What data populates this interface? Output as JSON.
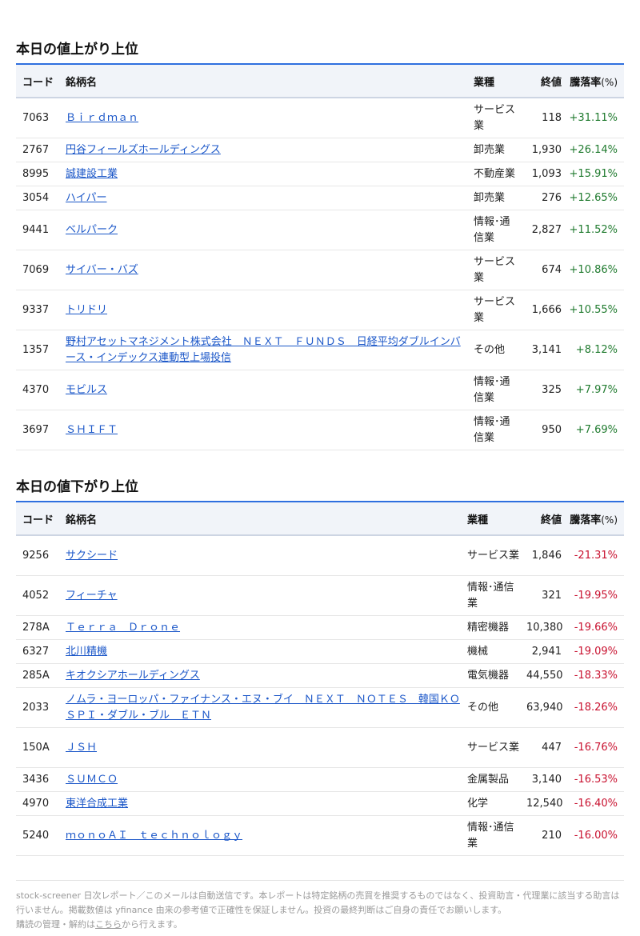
{
  "gainers": {
    "title": "本日の値上がり上位",
    "headers": {
      "code": "コード",
      "name": "銘柄名",
      "sector": "業種",
      "close": "終値",
      "change": "騰落率",
      "unit": "(%)"
    },
    "rows": [
      {
        "code": "7063",
        "name": "Ｂｉｒｄｍａｎ",
        "sector": "サービス業",
        "close": "118",
        "change": "+31.11%"
      },
      {
        "code": "2767",
        "name": "円谷フィールズホールディングス",
        "sector": "卸売業",
        "close": "1,930",
        "change": "+26.14%"
      },
      {
        "code": "8995",
        "name": "誠建設工業",
        "sector": "不動産業",
        "close": "1,093",
        "change": "+15.91%"
      },
      {
        "code": "3054",
        "name": "ハイパー",
        "sector": "卸売業",
        "close": "276",
        "change": "+12.65%"
      },
      {
        "code": "9441",
        "name": "ベルパーク",
        "sector": "情報･通信業",
        "close": "2,827",
        "change": "+11.52%"
      },
      {
        "code": "7069",
        "name": "サイバー・バズ",
        "sector": "サービス業",
        "close": "674",
        "change": "+10.86%"
      },
      {
        "code": "9337",
        "name": "トリドリ",
        "sector": "サービス業",
        "close": "1,666",
        "change": "+10.55%"
      },
      {
        "code": "1357",
        "name": "野村アセットマネジメント株式会社　ＮＥＸＴ　ＦＵＮＤＳ　日経平均ダブルインバース・インデックス連動型上場投信",
        "sector": "その他",
        "close": "3,141",
        "change": "+8.12%"
      },
      {
        "code": "4370",
        "name": "モビルス",
        "sector": "情報･通信業",
        "close": "325",
        "change": "+7.97%"
      },
      {
        "code": "3697",
        "name": "ＳＨＩＦＴ",
        "sector": "情報･通信業",
        "close": "950",
        "change": "+7.69%"
      }
    ]
  },
  "losers": {
    "title": "本日の値下がり上位",
    "headers": {
      "code": "コード",
      "name": "銘柄名",
      "sector": "業種",
      "close": "終値",
      "change": "騰落率",
      "unit": "(%)"
    },
    "rows": [
      {
        "code": "9256",
        "name": "サクシード",
        "sector": "サービス業",
        "close": "1,846",
        "change": "-21.31%"
      },
      {
        "code": "4052",
        "name": "フィーチャ",
        "sector": "情報･通信業",
        "close": "321",
        "change": "-19.95%"
      },
      {
        "code": "278A",
        "name": "Ｔｅｒｒａ　Ｄｒｏｎｅ",
        "sector": "精密機器",
        "close": "10,380",
        "change": "-19.66%"
      },
      {
        "code": "6327",
        "name": "北川精機",
        "sector": "機械",
        "close": "2,941",
        "change": "-19.09%"
      },
      {
        "code": "285A",
        "name": "キオクシアホールディングス",
        "sector": "電気機器",
        "close": "44,550",
        "change": "-18.33%"
      },
      {
        "code": "2033",
        "name": "ノムラ・ヨーロッパ・ファイナンス・エヌ・ブイ　ＮＥＸＴ　ＮＯＴＥＳ　韓国ＫＯＳＰＩ・ダブル・ブル　ＥＴＮ",
        "sector": "その他",
        "close": "63,940",
        "change": "-18.26%"
      },
      {
        "code": "150A",
        "name": "ＪＳＨ",
        "sector": "サービス業",
        "close": "447",
        "change": "-16.76%"
      },
      {
        "code": "3436",
        "name": "ＳＵＭＣＯ",
        "sector": "金属製品",
        "close": "3,140",
        "change": "-16.53%"
      },
      {
        "code": "4970",
        "name": "東洋合成工業",
        "sector": "化学",
        "close": "12,540",
        "change": "-16.40%"
      },
      {
        "code": "5240",
        "name": "ｍｏｎｏＡＩ　ｔｅｃｈｎｏｌｏｇｙ",
        "sector": "情報･通信業",
        "close": "210",
        "change": "-16.00%"
      }
    ]
  },
  "footer": {
    "line1": "stock-screener 日次レポート／このメールは自動送信です。本レポートは特定銘柄の売買を推奨するものではなく、投資助言・代理業に該当する助言は行いません。掲載数値は yfinance 由来の参考値で正確性を保証しません。投資の最終判断はご自身の責任でお願いします。",
    "unsubscribe_prefix": "購読の管理・解約は",
    "unsubscribe_link": "こちら",
    "unsubscribe_suffix": "から行えます。"
  }
}
